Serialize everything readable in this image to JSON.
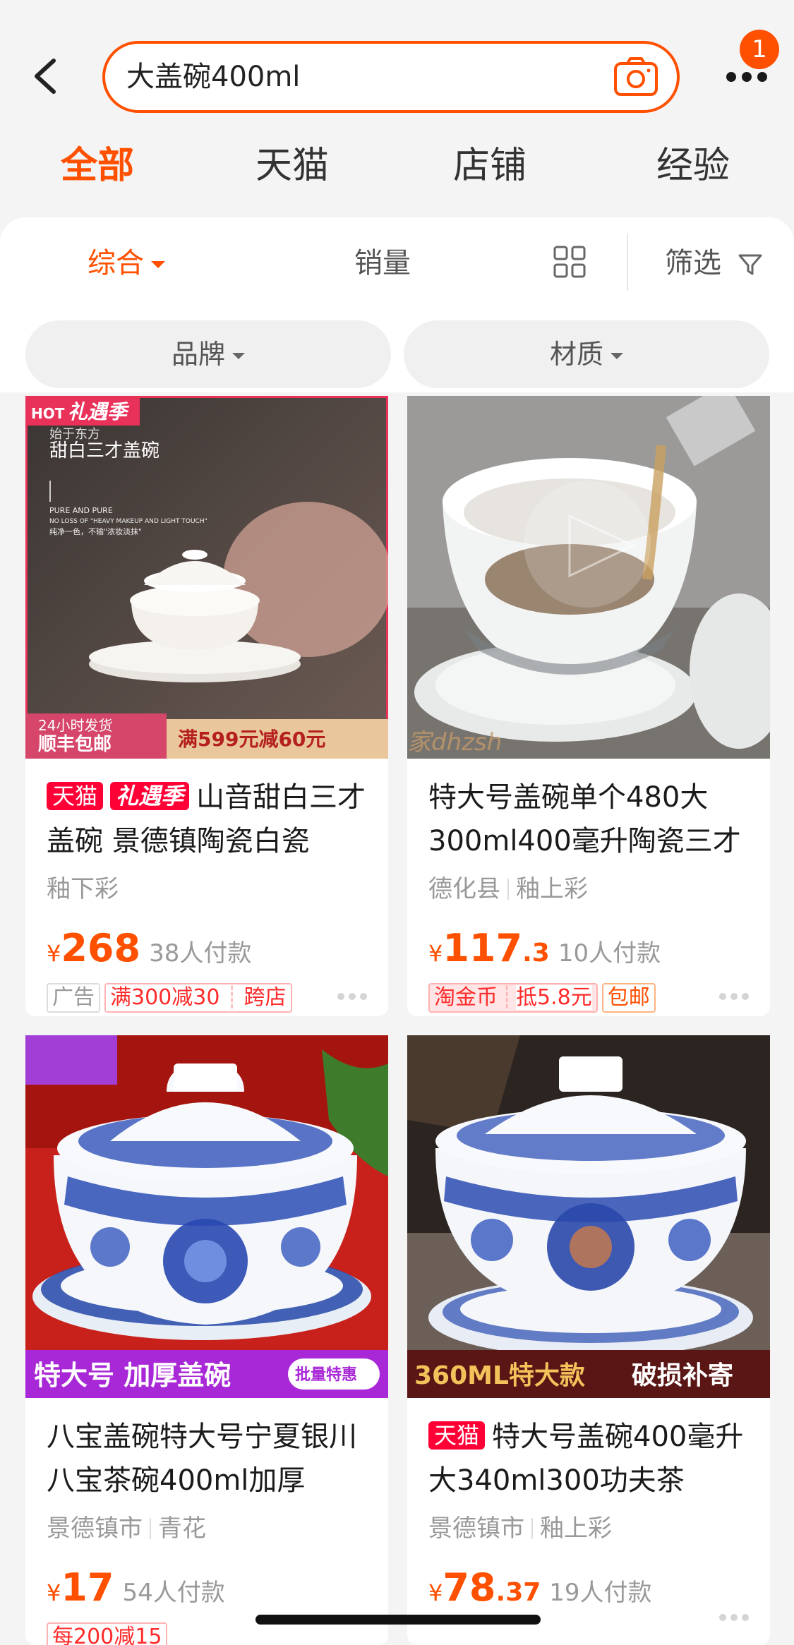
{
  "search": {
    "query": "大盖碗400ml"
  },
  "header": {
    "message_count": "1"
  },
  "tabs": [
    {
      "label": "全部",
      "active": true
    },
    {
      "label": "天猫"
    },
    {
      "label": "店铺"
    },
    {
      "label": "经验"
    }
  ],
  "sort": {
    "comprehensive": "综合",
    "sales": "销量",
    "filter": "筛选"
  },
  "chips": [
    {
      "label": "品牌"
    },
    {
      "label": "材质"
    }
  ],
  "products": [
    {
      "tags": [
        "天猫",
        "礼遇季"
      ],
      "title": "山音甜白三才盖碗 景德镇陶瓷白瓷",
      "attrs": [
        "釉下彩"
      ],
      "price_int": "268",
      "price_dec": "",
      "sales": "38人付款",
      "promos": [
        "广告",
        "满300减30",
        "跨店"
      ],
      "image": {
        "ribbon": "礼遇季",
        "hot": "HOT",
        "headline": "甜白三才盖碗",
        "sub_small": "始于东方",
        "en1": "PURE AND PURE",
        "en2": "NO LOSS OF \"HEAVY MAKEUP AND LIGHT TOUCH\"",
        "cn_small": "纯净一色，不输\"浓妆淡抹\"",
        "badge1": "24小时发货",
        "badge2": "顺丰包邮",
        "discount": "满599元减60元"
      }
    },
    {
      "tags": [],
      "title": "特大号盖碗单个480大300ml400毫升陶瓷三才",
      "attrs": [
        "德化县",
        "釉上彩"
      ],
      "price_int": "117",
      "price_dec": ".3",
      "sales": "10人付款",
      "promos": [
        "淘金币",
        "抵5.8元",
        "包邮"
      ],
      "image": {
        "watermark": "家dhzsh"
      }
    },
    {
      "tags": [],
      "title": "八宝盖碗特大号宁夏银川八宝茶碗400ml加厚",
      "attrs": [
        "景德镇市",
        "青花"
      ],
      "price_int": "17",
      "price_dec": "",
      "sales": "54人付款",
      "promos": [
        "每200减15"
      ],
      "image": {
        "banner": "特大号 加厚盖碗",
        "pill": "批量特惠"
      }
    },
    {
      "tags": [
        "天猫"
      ],
      "title": "特大号盖碗400毫升 大340ml300功夫茶",
      "attrs": [
        "景德镇市",
        "釉上彩"
      ],
      "price_int": "78",
      "price_dec": ".37",
      "sales": "19人付款",
      "promos": [],
      "image": {
        "banner_left": "360ML特大款",
        "banner_right": "破损补寄"
      }
    }
  ],
  "colors": {
    "accent": "#ff5000",
    "tmall_red": "#ff0036"
  }
}
